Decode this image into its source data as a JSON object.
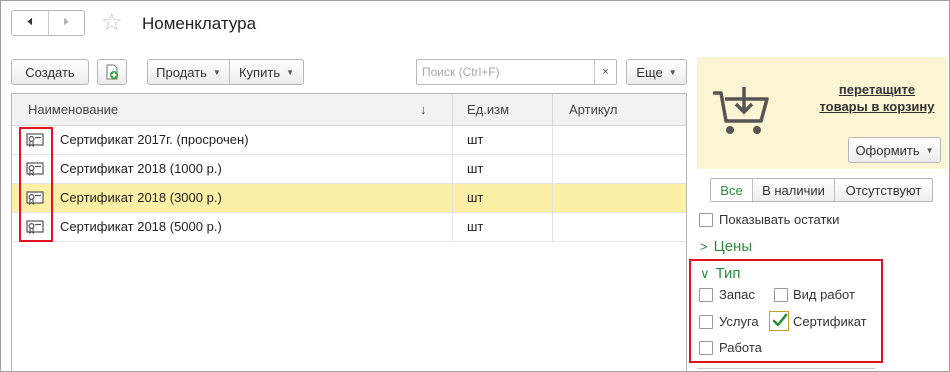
{
  "header": {
    "back_icon": "arrow-left-icon",
    "forward_icon": "arrow-right-icon",
    "favorite_icon": "star-icon",
    "title": "Номенклатура"
  },
  "toolbar": {
    "create_label": "Создать",
    "copy_icon": "copy-document-icon",
    "sell_label": "Продать",
    "buy_label": "Купить",
    "search_placeholder": "Поиск (Ctrl+F)",
    "search_value": "",
    "clear_label": "×",
    "more_label": "Еще"
  },
  "table": {
    "columns": {
      "name": "Наименование",
      "sort_indicator": "↓",
      "unit": "Ед.изм",
      "article": "Артикул"
    },
    "rows": [
      {
        "icon": "certificate-icon",
        "name": "Сертификат 2017г. (просрочен)",
        "unit": "шт",
        "article": "",
        "selected": false
      },
      {
        "icon": "certificate-icon",
        "name": "Сертификат 2018 (1000 р.)",
        "unit": "шт",
        "article": "",
        "selected": false
      },
      {
        "icon": "certificate-icon",
        "name": "Сертификат 2018 (3000 р.)",
        "unit": "шт",
        "article": "",
        "selected": true
      },
      {
        "icon": "certificate-icon",
        "name": "Сертификат 2018 (5000 р.)",
        "unit": "шт",
        "article": "",
        "selected": false
      }
    ]
  },
  "cart": {
    "icon": "cart-icon",
    "link_line1": "перетащите",
    "link_line2": "товары в корзину",
    "checkout_label": "Оформить"
  },
  "filter": {
    "availability": {
      "all": "Все",
      "in_stock": "В наличии",
      "absent": "Отсутствуют",
      "selected": "all"
    },
    "show_remainders_label": "Показывать остатки",
    "show_remainders_checked": false,
    "prices_section": "Цены",
    "type_section": "Тип",
    "types": {
      "stock": {
        "label": "Запас",
        "checked": false
      },
      "work_kind": {
        "label": "Вид работ",
        "checked": false
      },
      "service": {
        "label": "Услуга",
        "checked": false
      },
      "certificate": {
        "label": "Сертификат",
        "checked": true
      },
      "work": {
        "label": "Работа",
        "checked": false
      }
    }
  },
  "colors": {
    "accent_green": "#2d8c3c",
    "selection_yellow": "#fbf0a6",
    "cart_panel": "#fbf5d3",
    "highlight_red": "#e0141e"
  }
}
